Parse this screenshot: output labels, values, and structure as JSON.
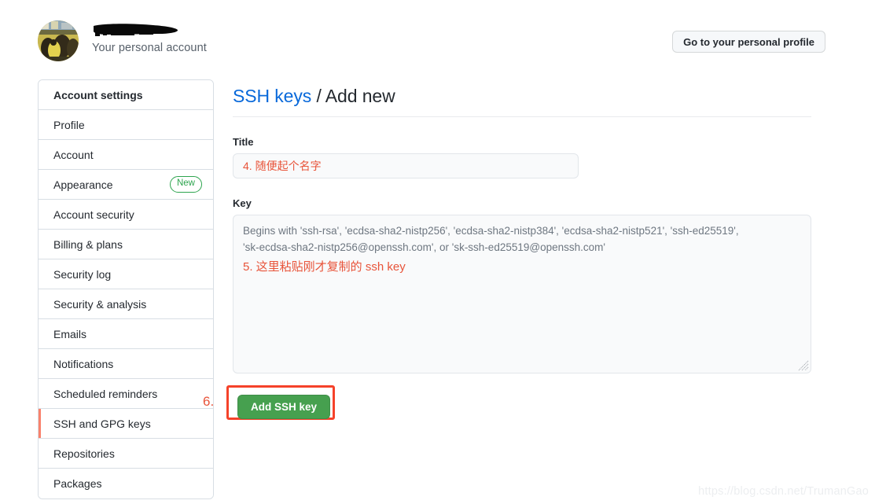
{
  "header": {
    "account_name_redacted": true,
    "account_subtitle": "Your personal account",
    "profile_button_label": "Go to your personal profile",
    "avatar_icon": "user-photo-avatar"
  },
  "sidebar": {
    "items": [
      {
        "label": "Account settings",
        "is_header": true,
        "active": false,
        "badge": ""
      },
      {
        "label": "Profile",
        "is_header": false,
        "active": false,
        "badge": ""
      },
      {
        "label": "Account",
        "is_header": false,
        "active": false,
        "badge": ""
      },
      {
        "label": "Appearance",
        "is_header": false,
        "active": false,
        "badge": "New"
      },
      {
        "label": "Account security",
        "is_header": false,
        "active": false,
        "badge": ""
      },
      {
        "label": "Billing & plans",
        "is_header": false,
        "active": false,
        "badge": ""
      },
      {
        "label": "Security log",
        "is_header": false,
        "active": false,
        "badge": ""
      },
      {
        "label": "Security & analysis",
        "is_header": false,
        "active": false,
        "badge": ""
      },
      {
        "label": "Emails",
        "is_header": false,
        "active": false,
        "badge": ""
      },
      {
        "label": "Notifications",
        "is_header": false,
        "active": false,
        "badge": ""
      },
      {
        "label": "Scheduled reminders",
        "is_header": false,
        "active": false,
        "badge": ""
      },
      {
        "label": "SSH and GPG keys",
        "is_header": false,
        "active": true,
        "badge": ""
      },
      {
        "label": "Repositories",
        "is_header": false,
        "active": false,
        "badge": ""
      },
      {
        "label": "Packages",
        "is_header": false,
        "active": false,
        "badge": ""
      }
    ]
  },
  "main": {
    "title_link": "SSH keys",
    "title_separator": " / ",
    "title_current": "Add new",
    "title_field": {
      "label": "Title",
      "value": "4. 随便起个名字",
      "placeholder": ""
    },
    "key_field": {
      "label": "Key",
      "placeholder_line1": "Begins with 'ssh-rsa', 'ecdsa-sha2-nistp256', 'ecdsa-sha2-nistp384', 'ecdsa-sha2-nistp521', 'ssh-ed25519',",
      "placeholder_line2": "'sk-ecdsa-sha2-nistp256@openssh.com', or 'sk-ssh-ed25519@openssh.com'",
      "annotation": "5. 这里粘贴刚才复制的 ssh key"
    },
    "submit": {
      "label": "Add SSH key",
      "step_marker": "6."
    }
  },
  "watermark": {
    "text": "https://blog.csdn.net/TrumanGao"
  },
  "colors": {
    "accent_link": "#0969da",
    "button_green": "#46a04f",
    "annotation_red": "#e8543a",
    "highlight_red": "#f5422a",
    "active_border": "#f9826c",
    "badge_green": "#2da44e"
  }
}
